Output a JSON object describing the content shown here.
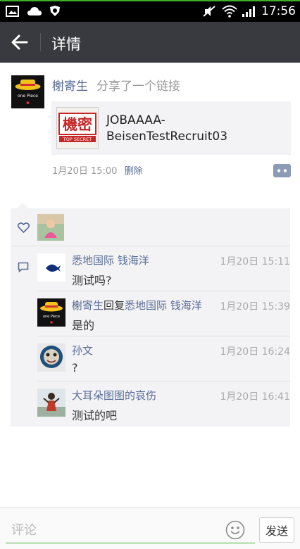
{
  "status_bar": {
    "time": "17:56"
  },
  "header": {
    "title": "详情"
  },
  "post": {
    "author": "榭寄生",
    "action": "分享了一个链接",
    "link_title": "JOBAAAA-BeisenTestRecruit03",
    "link_thumb_text": "機密",
    "link_thumb_sub": "TOP SECRET",
    "avatar_text": "one Piece",
    "time": "1月20日 15:00",
    "delete_label": "删除"
  },
  "comments": [
    {
      "name": "悉地国际 钱海洋",
      "time": "1月20日 15:11",
      "text": "测试吗?"
    },
    {
      "name": "榭寄生",
      "reply_word": "回复",
      "reply_to": "悉地国际 钱海洋",
      "time": "1月20日 15:39",
      "text": "是的"
    },
    {
      "name": "孙文",
      "time": "1月20日 16:24",
      "text": "?"
    },
    {
      "name": "大耳朵图图的哀伤",
      "time": "1月20日 16:41",
      "text": "测试的吧"
    }
  ],
  "bottom_bar": {
    "placeholder": "评论",
    "send_label": "发送"
  },
  "icons": [
    "back-arrow-icon",
    "heart-icon",
    "comment-icon",
    "emoji-icon",
    "more-icon",
    "wifi-icon",
    "signal-icon",
    "mute-icon"
  ],
  "colors": {
    "accent": "#3fae2a",
    "link": "#576b95",
    "header_bg": "#393a3f",
    "panel_bg": "#f3f3f5"
  }
}
